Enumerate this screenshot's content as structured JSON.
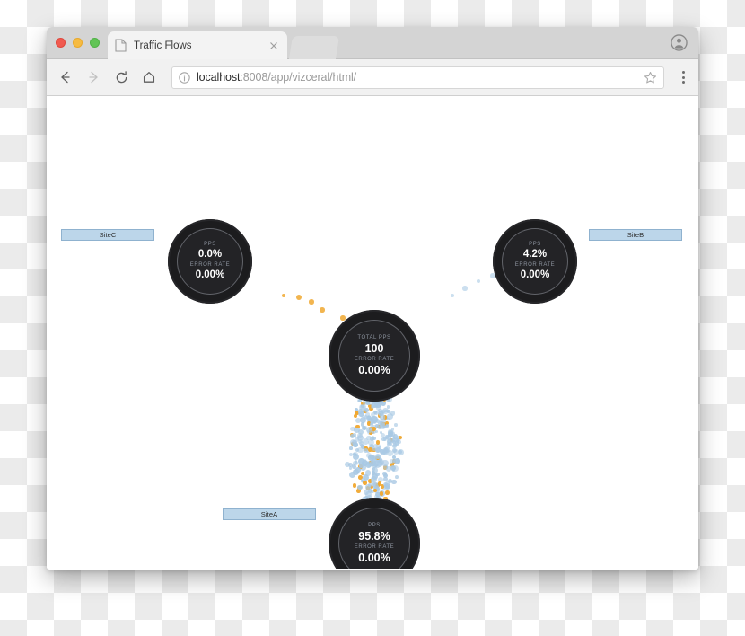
{
  "browser": {
    "tab": {
      "title": "Traffic Flows",
      "favicon": "page-icon",
      "close": "close-icon"
    },
    "url": {
      "host": "localhost",
      "path": ":8008/app/vizceral/html/",
      "full": "localhost:8008/app/vizceral/html/"
    },
    "controls": {
      "back": "back-arrow-icon",
      "forward": "forward-arrow-icon",
      "reload": "reload-icon",
      "home": "home-icon",
      "info": "info-icon",
      "bookmark": "star-icon",
      "menu": "three-dot-menu-icon",
      "profile": "profile-avatar-icon"
    },
    "window_buttons": {
      "close": "close-window",
      "minimize": "minimize-window",
      "zoom": "zoom-window"
    }
  },
  "labels": {
    "pps": "PPS",
    "total_pps": "TOTAL PPS",
    "error_rate": "ERROR RATE"
  },
  "graph": {
    "nodes": [
      {
        "id": "sitec",
        "label": "SiteC",
        "metric_label": "PPS",
        "metric_value": "0.0%",
        "error_label": "ERROR RATE",
        "error_value": "0.00%"
      },
      {
        "id": "siteb",
        "label": "SiteB",
        "metric_label": "PPS",
        "metric_value": "4.2%",
        "error_label": "ERROR RATE",
        "error_value": "0.00%"
      },
      {
        "id": "central",
        "label": "",
        "metric_label": "TOTAL PPS",
        "metric_value": "100",
        "error_label": "ERROR RATE",
        "error_value": "0.00%"
      },
      {
        "id": "sitea",
        "label": "SiteA",
        "metric_label": "PPS",
        "metric_value": "95.8%",
        "error_label": "ERROR RATE",
        "error_value": "0.00%"
      }
    ]
  },
  "colors": {
    "particle_normal": "#a9c9e4",
    "particle_warning": "#f0a830",
    "node_fill": "#1c1c1e",
    "label_fill": "#bcd6ea",
    "label_border": "#8fb2cf"
  }
}
